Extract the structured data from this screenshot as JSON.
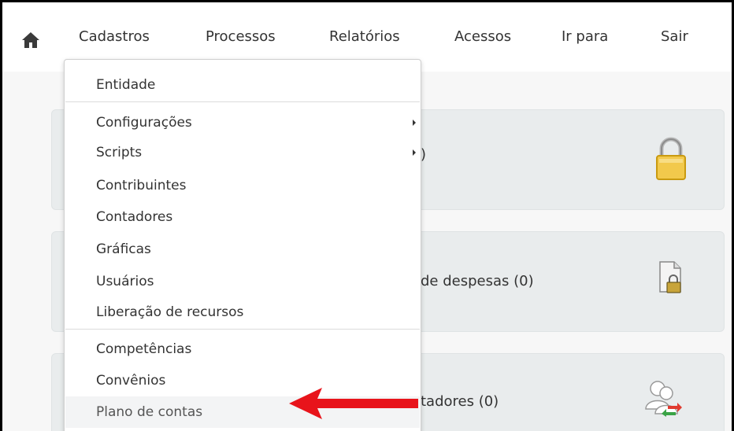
{
  "nav": {
    "home_icon": "home-icon",
    "items": [
      "Cadastros",
      "Processos",
      "Relatórios",
      "Acessos",
      "Ir para",
      "Sair"
    ]
  },
  "cards": [
    {
      "label_fragment": ")",
      "icon": "lock-icon"
    },
    {
      "label_fragment": "de despesas (0)",
      "icon": "document-lock-icon"
    },
    {
      "label_fragment": "tadores (0)",
      "icon": "users-transfer-icon"
    }
  ],
  "dropdown": {
    "items": [
      {
        "label": "Entidade"
      },
      {
        "label": "Configurações",
        "has_submenu": true
      },
      {
        "label": "Scripts",
        "has_submenu": true
      },
      {
        "label": "Contribuintes"
      },
      {
        "label": "Contadores"
      },
      {
        "label": "Gráficas"
      },
      {
        "label": "Usuários"
      },
      {
        "label": "Liberação de recursos"
      },
      {
        "label": "Competências"
      },
      {
        "label": "Convênios"
      },
      {
        "label": "Plano de contas",
        "highlighted": true
      }
    ]
  },
  "annotation": {
    "arrow_color": "#e8141b"
  }
}
